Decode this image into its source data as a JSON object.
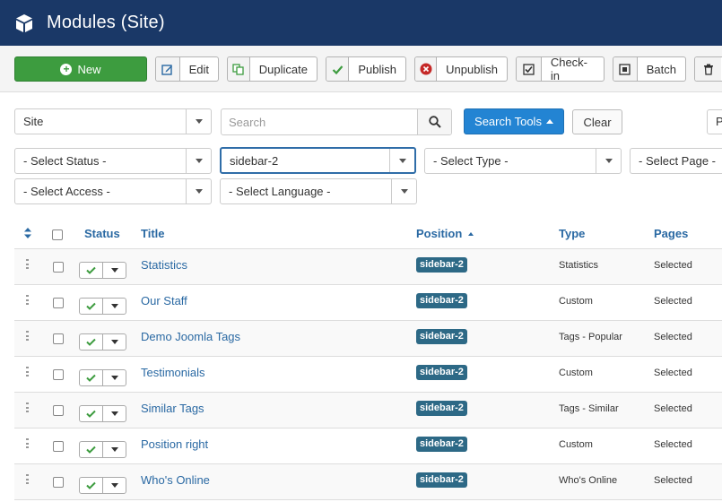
{
  "header": {
    "title": "Modules (Site)",
    "icon": "cube-icon"
  },
  "toolbar": {
    "new": "New",
    "edit": "Edit",
    "duplicate": "Duplicate",
    "publish": "Publish",
    "unpublish": "Unpublish",
    "checkin": "Check-in",
    "batch": "Batch"
  },
  "filters": {
    "client": "Site",
    "search_placeholder": "Search",
    "search_tools": "Search Tools",
    "clear": "Clear",
    "edge_label": "P",
    "status": "- Select Status -",
    "position": "sidebar-2",
    "type": "- Select Type -",
    "page": "- Select Page -",
    "access": "- Select Access -",
    "language": "- Select Language -"
  },
  "table": {
    "columns": {
      "status": "Status",
      "title": "Title",
      "position": "Position",
      "type": "Type",
      "pages": "Pages"
    },
    "rows": [
      {
        "title": "Statistics",
        "position": "sidebar-2",
        "type": "Statistics",
        "pages": "Selected"
      },
      {
        "title": "Our Staff",
        "position": "sidebar-2",
        "type": "Custom",
        "pages": "Selected"
      },
      {
        "title": "Demo Joomla Tags",
        "position": "sidebar-2",
        "type": "Tags - Popular",
        "pages": "Selected"
      },
      {
        "title": "Testimonials",
        "position": "sidebar-2",
        "type": "Custom",
        "pages": "Selected"
      },
      {
        "title": "Similar Tags",
        "position": "sidebar-2",
        "type": "Tags - Similar",
        "pages": "Selected"
      },
      {
        "title": "Position right",
        "position": "sidebar-2",
        "type": "Custom",
        "pages": "Selected"
      },
      {
        "title": "Who's Online",
        "position": "sidebar-2",
        "type": "Who's Online",
        "pages": "Selected"
      }
    ]
  },
  "colors": {
    "header": "#1a3867",
    "new_button": "#3d9c3f",
    "search_tools": "#2384d3",
    "link": "#2a69a3",
    "badge": "#2d6986"
  }
}
